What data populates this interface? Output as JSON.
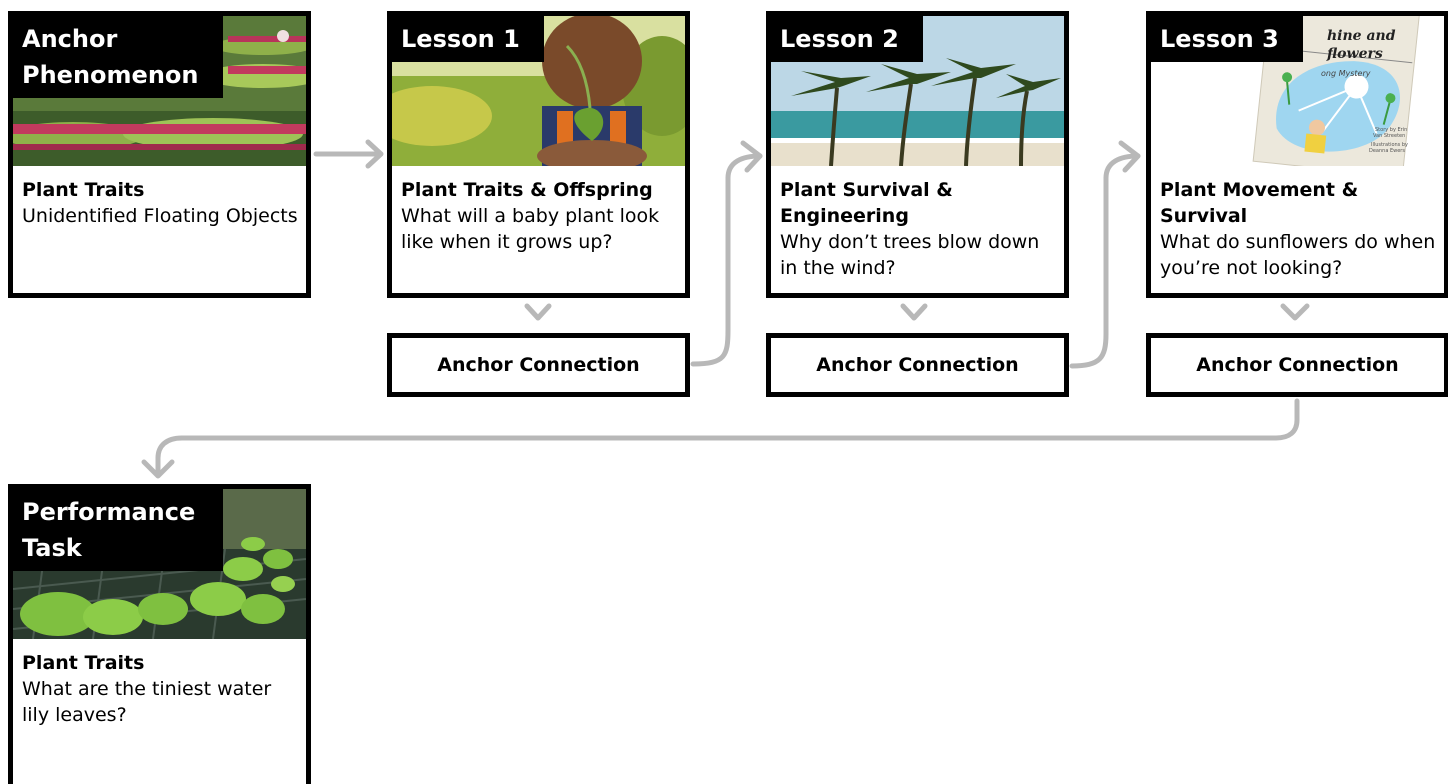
{
  "cards": {
    "anchor": {
      "title": "Anchor Phenomenon",
      "subtitle": "Plant Traits",
      "question": "Unidentified Floating Objects",
      "image": "giant-water-lily-pads-photo"
    },
    "lesson1": {
      "title": "Lesson 1",
      "subtitle": "Plant Traits & Offspring",
      "question": "What will a baby plant look like when it grows up?",
      "image": "child-holding-seedling-photo"
    },
    "lesson2": {
      "title": "Lesson 2",
      "subtitle": "Plant Survival & Engineering",
      "question": "Why don’t trees blow down in the wind?",
      "image": "palm-trees-wind-beach-photo"
    },
    "lesson3": {
      "title": "Lesson 3",
      "subtitle": "Plant Movement & Survival",
      "question": "What do sunflowers do when you’re not looking?",
      "image": "book-cover-sunshine-sunflowers",
      "book_cover_lines": [
        "hine and",
        "flowers",
        "ong Mystery",
        "Story by Erin",
        "Van Streeten",
        "Illustrations by",
        "Deanna Ewers"
      ]
    },
    "performance": {
      "title": "Performance Task",
      "subtitle": "Plant Traits",
      "question": "What are the tiniest water lily leaves?",
      "image": "small-water-lily-leaves-photo"
    }
  },
  "connections": {
    "lesson1": "Anchor Connection",
    "lesson2": "Anchor Connection",
    "lesson3": "Anchor Connection"
  },
  "colors": {
    "border": "#000000",
    "arrow": "#b8b8b8",
    "badge_bg": "#000000",
    "badge_text": "#ffffff"
  }
}
